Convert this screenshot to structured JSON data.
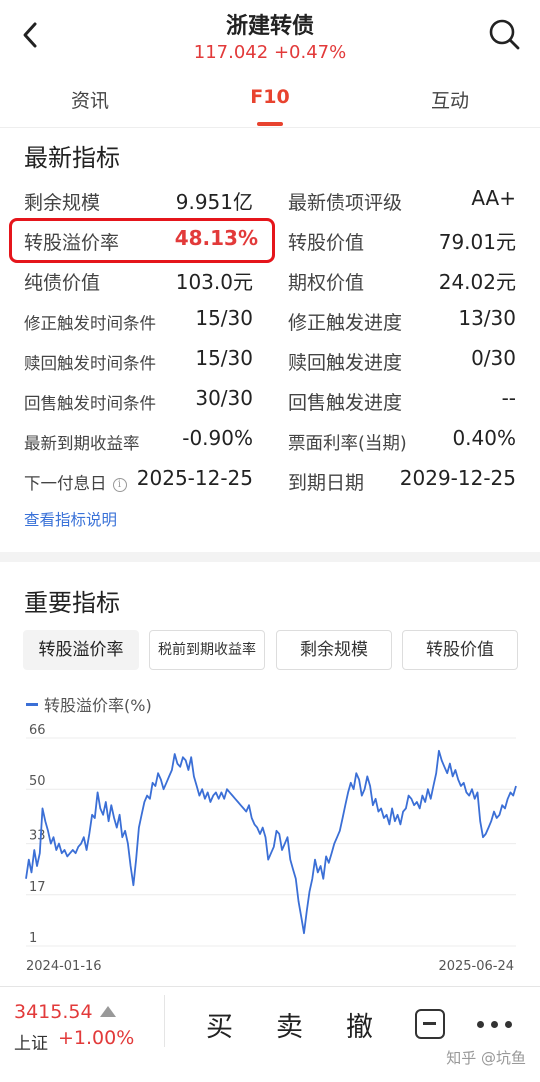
{
  "header": {
    "title": "浙建转债",
    "price": "117.042",
    "change": "+0.47%"
  },
  "tabs": [
    "资讯",
    "F10",
    "互动"
  ],
  "latest": {
    "section_title": "最新指标",
    "rows": [
      {
        "l1": "剩余规模",
        "v1": "9.951亿",
        "l2": "最新债项评级",
        "v2": "AA+"
      },
      {
        "l1": "转股溢价率",
        "v1": "48.13%",
        "l2": "转股价值",
        "v2": "79.01元"
      },
      {
        "l1": "纯债价值",
        "v1": "103.0元",
        "l2": "期权价值",
        "v2": "24.02元"
      },
      {
        "l1": "修正触发时间条件",
        "v1": "15/30",
        "l2": "修正触发进度",
        "v2": "13/30"
      },
      {
        "l1": "赎回触发时间条件",
        "v1": "15/30",
        "l2": "赎回触发进度",
        "v2": "0/30"
      },
      {
        "l1": "回售触发时间条件",
        "v1": "30/30",
        "l2": "回售触发进度",
        "v2": "--"
      },
      {
        "l1": "最新到期收益率",
        "v1": "-0.90%",
        "l2": "票面利率(当期)",
        "v2": "0.40%"
      },
      {
        "l1": "下一付息日",
        "v1": "2025-12-25",
        "l2": "到期日期",
        "v2": "2029-12-25"
      }
    ],
    "link": "查看指标说明"
  },
  "important": {
    "section_title": "重要指标",
    "chips": [
      "转股溢价率",
      "税前到期收益率",
      "剩余规模",
      "转股价值"
    ],
    "active_chip": 0
  },
  "chart_data": {
    "type": "line",
    "series": [
      {
        "name": "转股溢价率(%)",
        "color": "#3b6fd6"
      }
    ],
    "x_start": "2024-01-16",
    "x_end": "2025-06-24",
    "y_ticks": [
      "66",
      "50",
      "33",
      "17",
      "1"
    ],
    "ylim": [
      1,
      66
    ],
    "grid": true,
    "values": [
      22,
      28,
      24,
      31,
      26,
      30,
      44,
      40,
      37,
      33,
      35,
      31,
      33,
      30,
      31,
      29,
      30,
      31,
      30,
      32,
      33,
      35,
      31,
      36,
      42,
      41,
      49,
      44,
      42,
      46,
      40,
      45,
      41,
      38,
      42,
      35,
      37,
      33,
      26,
      20,
      28,
      38,
      42,
      46,
      48,
      47,
      52,
      51,
      55,
      53,
      50,
      52,
      54,
      56,
      61,
      58,
      57,
      60,
      59,
      56,
      60,
      54,
      51,
      48,
      50,
      47,
      49,
      46,
      48,
      49,
      47,
      49,
      47,
      50,
      49,
      48,
      47,
      46,
      45,
      44,
      43,
      45,
      41,
      39,
      38,
      36,
      38,
      35,
      28,
      30,
      32,
      37,
      36,
      31,
      33,
      35,
      28,
      25,
      22,
      15,
      10,
      5,
      12,
      18,
      22,
      28,
      24,
      26,
      22,
      29,
      27,
      30,
      33,
      35,
      37,
      41,
      45,
      49,
      52,
      50,
      55,
      53,
      48,
      50,
      54,
      51,
      45,
      47,
      43,
      44,
      41,
      42,
      39,
      44,
      40,
      42,
      39,
      43,
      44,
      48,
      47,
      45,
      46,
      44,
      48,
      46,
      50,
      47,
      51,
      55,
      62,
      59,
      57,
      55,
      58,
      54,
      56,
      53,
      51,
      52,
      49,
      48,
      50,
      47,
      49,
      40,
      35,
      36,
      38,
      40,
      43,
      41,
      42,
      45,
      44,
      47,
      49,
      48,
      51
    ]
  },
  "bottom": {
    "index_value": "3415.54",
    "index_name": "上证",
    "index_change": "+1.00%",
    "actions": [
      "买",
      "卖",
      "撤"
    ],
    "watermark": "知乎 @坑鱼"
  }
}
